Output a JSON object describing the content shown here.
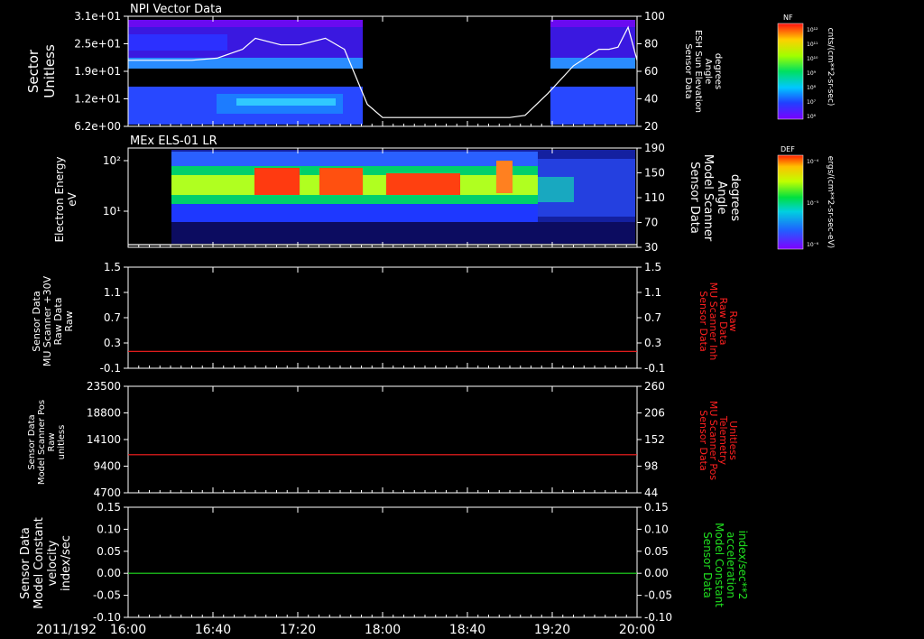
{
  "time_axis": {
    "date_label": "2011/192",
    "ticks": [
      "16:00",
      "16:40",
      "17:20",
      "18:00",
      "18:40",
      "19:20",
      "20:00"
    ],
    "range_hours": [
      16,
      20
    ]
  },
  "colors": {
    "white": "#ffffff",
    "red": "#ff2020",
    "green": "#20e020"
  },
  "chart_data": [
    {
      "type": "heatmap",
      "title": "NPI Vector Data",
      "ylabel": [
        "Sector",
        "Unitless"
      ],
      "yticks": [
        "3.1e+01",
        "2.5e+01",
        "1.9e+01",
        "1.2e+01",
        "6.2e+00"
      ],
      "ylabel_right": [
        "Sensor Data",
        "ESH Sun Elevation",
        "Angle",
        "degrees"
      ],
      "yticks_right": [
        "100",
        "80",
        "60",
        "40",
        "20"
      ],
      "ylim_right": [
        0,
        100
      ],
      "data_gap_hours": [
        17.72,
        19.1
      ],
      "colorbar": {
        "label": "NF",
        "units": "cnts/(cm**2-sr-sec)",
        "ticks": [
          "10¹²",
          "10¹¹",
          "10¹⁰",
          "10⁹",
          "10⁸",
          "10⁷",
          "10⁶"
        ]
      },
      "line_series": {
        "name": "ESH Sun Elevation",
        "x_hours": [
          16.0,
          16.5,
          16.7,
          16.9,
          17.0,
          17.2,
          17.35,
          17.55,
          17.7,
          17.88,
          18.0,
          18.5,
          19.0,
          19.12,
          19.3,
          19.5,
          19.7,
          19.78,
          19.85,
          19.93,
          20.0
        ],
        "values": [
          60,
          60,
          62,
          70,
          80,
          74,
          74,
          80,
          70,
          20,
          8,
          8,
          8,
          10,
          30,
          55,
          70,
          70,
          72,
          90,
          60
        ]
      }
    },
    {
      "type": "heatmap",
      "title": "MEx ELS-01 LR",
      "ylabel": [
        "Electron Energy",
        "eV"
      ],
      "yticks": [
        "10²",
        "10¹"
      ],
      "ylabel_right": [
        "Sensor Data",
        "Model Scanner",
        "Angle",
        "degrees"
      ],
      "yticks_right": [
        "190",
        "150",
        "110",
        "70",
        "30"
      ],
      "ylim_right": [
        0,
        190
      ],
      "colorbar": {
        "label": "DEF",
        "units": "ergs/(cm**2-sr-sec-eV)",
        "ticks": [
          "10⁻⁴",
          "10⁻⁵",
          "10⁻⁶"
        ]
      },
      "line_series": {
        "name": "Model Scanner Angle",
        "x_hours": [
          16.0,
          20.0
        ],
        "values": [
          5,
          5
        ]
      }
    },
    {
      "type": "line",
      "ylabel": [
        "Sensor Data",
        "MU Scanner +30V",
        "Raw Data",
        "Raw"
      ],
      "yticks": [
        "1.5",
        "1.1",
        "0.7",
        "0.3",
        "-0.1"
      ],
      "ylim": [
        -0.3,
        1.5
      ],
      "ylabel_right": [
        "Sensor Data",
        "MU Scanner Inh",
        "Raw Data",
        "Raw"
      ],
      "yticks_right": [
        "1.5",
        "1.1",
        "0.7",
        "0.3",
        "-0.1"
      ],
      "series": [
        {
          "name": "MU Scanner Inh",
          "x_hours": [
            16.0,
            20.0
          ],
          "values": [
            0.0,
            0.0
          ]
        }
      ]
    },
    {
      "type": "line",
      "ylabel": [
        "Sensor Data",
        "Model Scanner Pos",
        "Raw",
        "unitless"
      ],
      "yticks": [
        "23500",
        "18800",
        "14100",
        "9400",
        "4700"
      ],
      "ylim": [
        0,
        23500
      ],
      "ylabel_right": [
        "Sensor Data",
        "MU Scanner Pos",
        "Telemetry",
        "Unitless"
      ],
      "yticks_right": [
        "260",
        "206",
        "152",
        "98",
        "44"
      ],
      "series": [
        {
          "name": "MU Scanner Pos",
          "x_hours": [
            16.0,
            20.0
          ],
          "values": [
            8400,
            8400
          ]
        }
      ]
    },
    {
      "type": "line",
      "ylabel": [
        "Sensor Data",
        "Model Constant",
        "velocity",
        "index/sec"
      ],
      "yticks": [
        "0.15",
        "0.10",
        "0.05",
        "0.00",
        "-0.05",
        "-0.10"
      ],
      "ylim": [
        -0.1,
        0.15
      ],
      "ylabel_right": [
        "Sensor Data",
        "Model Constant",
        "acceleration",
        "index/sec**2"
      ],
      "yticks_right": [
        "0.15",
        "0.10",
        "0.05",
        "0.00",
        "-0.05",
        "-0.10"
      ],
      "series": [
        {
          "name": "Model Constant acceleration",
          "x_hours": [
            16.0,
            20.0
          ],
          "values": [
            0.0,
            0.0
          ]
        }
      ]
    }
  ]
}
